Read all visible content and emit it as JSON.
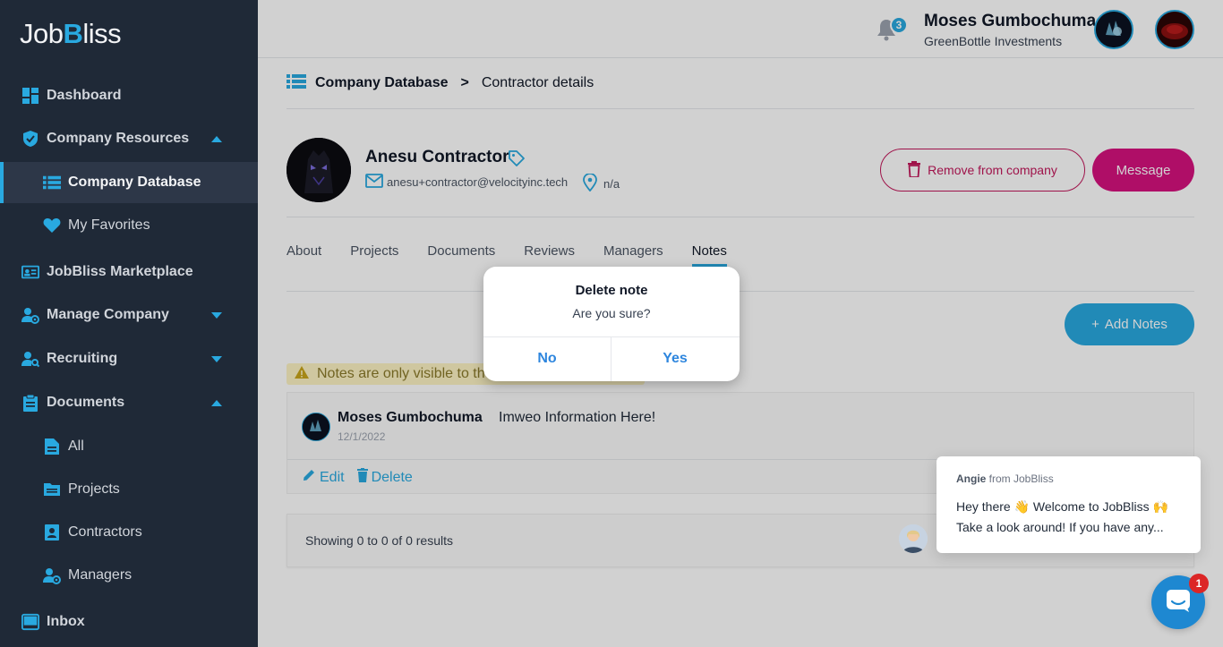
{
  "app": {
    "logo_prefix": "Job",
    "logo_b": "B",
    "logo_suffix": "liss"
  },
  "colors": {
    "accent": "#29a9e0",
    "sidebar_bg": "#1f2937",
    "danger": "#c2185b",
    "message": "#d6127e"
  },
  "sidebar": {
    "items": [
      {
        "label": "Dashboard",
        "icon": "dashboard-icon"
      },
      {
        "label": "Company Resources",
        "icon": "shield-check-icon"
      },
      {
        "label": "Company Database",
        "icon": "database-list-icon"
      },
      {
        "label": "My Favorites",
        "icon": "heart-icon"
      },
      {
        "label": "JobBliss Marketplace",
        "icon": "id-card-icon"
      },
      {
        "label": "Manage Company",
        "icon": "user-gear-icon"
      },
      {
        "label": "Recruiting",
        "icon": "user-search-icon"
      },
      {
        "label": "Documents",
        "icon": "clipboard-icon"
      },
      {
        "label": "All",
        "icon": "file-icon"
      },
      {
        "label": "Projects",
        "icon": "folder-icon"
      },
      {
        "label": "Contractors",
        "icon": "contract-icon"
      },
      {
        "label": "Managers",
        "icon": "user-gear-icon"
      },
      {
        "label": "Inbox",
        "icon": "inbox-icon"
      }
    ]
  },
  "header": {
    "notification_count": "3",
    "user_name": "Moses Gumbochuma",
    "user_company": "GreenBottle Investments"
  },
  "breadcrumb": {
    "parent": "Company Database",
    "separator": ">",
    "current": "Contractor details"
  },
  "profile": {
    "name": "Anesu Contractor",
    "email": "anesu+contractor@velocityinc.tech",
    "location": "n/a",
    "remove_label": "Remove from company",
    "message_label": "Message"
  },
  "tabs": [
    {
      "label": "About"
    },
    {
      "label": "Projects"
    },
    {
      "label": "Documents"
    },
    {
      "label": "Reviews"
    },
    {
      "label": "Managers"
    },
    {
      "label": "Notes",
      "active": true
    }
  ],
  "notes": {
    "add_label": "Add Notes",
    "add_prefix": "+",
    "warning_visible": "Notes are only visible to th",
    "items": [
      {
        "author": "Moses  Gumbochuma",
        "date": "12/1/2022",
        "text": "Imweo Information Here!",
        "edit_label": "Edit",
        "delete_label": "Delete"
      }
    ],
    "results_text": "Showing 0 to 0 of 0 results"
  },
  "modal": {
    "title": "Delete note",
    "message": "Are you sure?",
    "no_label": "No",
    "yes_label": "Yes"
  },
  "chat": {
    "agent_name": "Angie",
    "from_text": " from JobBliss",
    "line1": "Hey there 👋 Welcome to JobBliss 🙌",
    "line2": "Take a look around! If you have any...",
    "unread_count": "1"
  }
}
